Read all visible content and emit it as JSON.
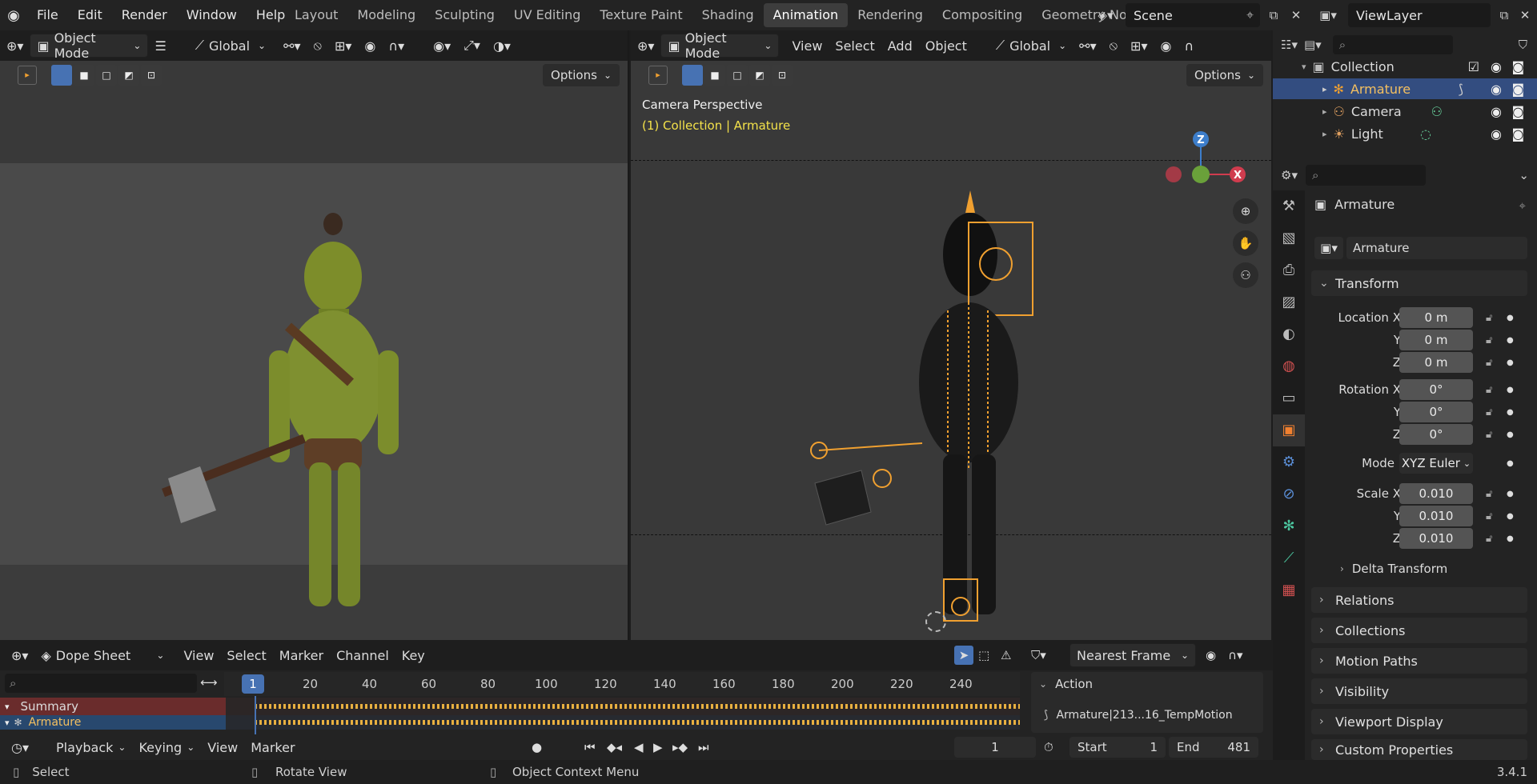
{
  "menu": {
    "file": "File",
    "edit": "Edit",
    "render": "Render",
    "window": "Window",
    "help": "Help"
  },
  "workspaces": [
    "Layout",
    "Modeling",
    "Sculpting",
    "UV Editing",
    "Texture Paint",
    "Shading",
    "Animation",
    "Rendering",
    "Compositing",
    "Geometry Node"
  ],
  "scene": "Scene",
  "view_layer": "ViewLayer",
  "left_viewport": {
    "mode": "Object Mode",
    "orientation": "Global",
    "options": "Options"
  },
  "right_viewport": {
    "mode": "Object Mode",
    "menu": [
      "View",
      "Select",
      "Add",
      "Object"
    ],
    "orientation": "Global",
    "options": "Options",
    "overlay_title": "Camera Perspective",
    "overlay_subtitle": "(1) Collection | Armature",
    "axis_z": "Z",
    "axis_x": "X"
  },
  "outliner": {
    "collection": "Collection",
    "items": [
      "Armature",
      "Camera",
      "Light"
    ]
  },
  "properties": {
    "object_name": "Armature",
    "data_name": "Armature",
    "transform_label": "Transform",
    "location_label": "Location X",
    "rotation_label": "Rotation X",
    "scale_label": "Scale X",
    "y": "Y",
    "z": "Z",
    "mode_label": "Mode",
    "location": [
      "0 m",
      "0 m",
      "0 m"
    ],
    "rotation": [
      "0°",
      "0°",
      "0°"
    ],
    "mode": "XYZ Euler",
    "scale": [
      "0.010",
      "0.010",
      "0.010"
    ],
    "panels": [
      "Delta Transform",
      "Relations",
      "Collections",
      "Motion Paths",
      "Visibility",
      "Viewport Display",
      "Custom Properties"
    ]
  },
  "dopesheet": {
    "editor": "Dope Sheet",
    "menu": [
      "View",
      "Select",
      "Marker",
      "Channel",
      "Key"
    ],
    "snap": "Nearest Frame",
    "frames": [
      "20",
      "40",
      "60",
      "80",
      "100",
      "120",
      "140",
      "160",
      "180",
      "200",
      "220",
      "240"
    ],
    "current_frame": "1",
    "channels": [
      "Summary",
      "Armature"
    ],
    "action_label": "Action",
    "action_name": "Armature|213...16_TempMotion"
  },
  "timeline": {
    "playback": "Playback",
    "keying": "Keying",
    "view": "View",
    "marker": "Marker",
    "frame": "1",
    "start_label": "Start",
    "start": "1",
    "end_label": "End",
    "end": "481"
  },
  "status": {
    "select": "Select",
    "rotate": "Rotate View",
    "context": "Object Context Menu",
    "version": "3.4.1"
  }
}
